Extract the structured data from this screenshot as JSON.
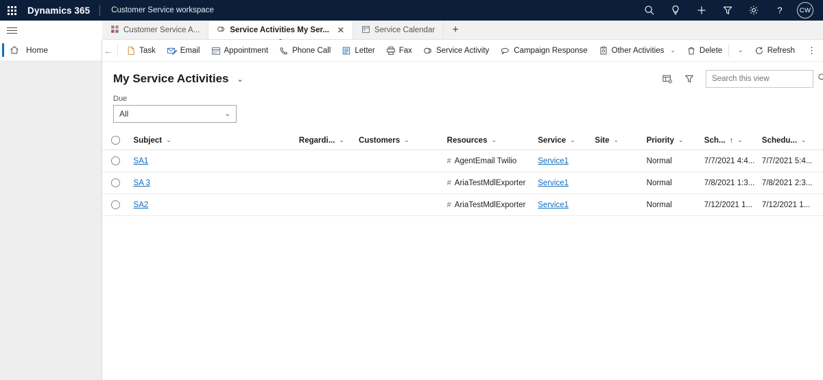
{
  "topbar": {
    "waffle_name": "app-launcher",
    "brand": "Dynamics 365",
    "app_name": "Customer Service workspace",
    "icons": [
      {
        "name": "search-icon",
        "label": "Search"
      },
      {
        "name": "lightbulb-icon",
        "label": "Tips"
      },
      {
        "name": "plus-icon",
        "label": "New"
      },
      {
        "name": "filter-icon",
        "label": "Filter"
      },
      {
        "name": "gear-icon",
        "label": "Settings"
      },
      {
        "name": "help-icon",
        "label": "Help"
      }
    ],
    "avatar_initials": "CW"
  },
  "sidebar": {
    "hamburger_label": "Site Map",
    "items": [
      {
        "label": "Home",
        "icon": "home-icon",
        "selected": true
      }
    ]
  },
  "tabs": [
    {
      "label": "Customer Service A...",
      "icon": "dashboard-icon",
      "active": false,
      "closable": false
    },
    {
      "label": "Service Activities My Ser...",
      "icon": "service-activity-icon",
      "active": true,
      "closable": true,
      "close_label": "✕",
      "unsaved_dot": true
    },
    {
      "label": "Service Calendar",
      "icon": "calendar-icon",
      "active": false,
      "closable": false
    }
  ],
  "tab_add_label": "+",
  "commandbar": {
    "back_label": "←",
    "items": [
      {
        "label": "Task",
        "icon": "task-icon"
      },
      {
        "label": "Email",
        "icon": "email-icon"
      },
      {
        "label": "Appointment",
        "icon": "appointment-icon"
      },
      {
        "label": "Phone Call",
        "icon": "phone-call-icon"
      },
      {
        "label": "Letter",
        "icon": "letter-icon"
      },
      {
        "label": "Fax",
        "icon": "fax-icon"
      },
      {
        "label": "Service Activity",
        "icon": "service-activity-icon"
      },
      {
        "label": "Campaign Response",
        "icon": "campaign-response-icon"
      },
      {
        "label": "Other Activities",
        "icon": "other-activities-icon",
        "caret": "⌄"
      },
      {
        "label": "Delete",
        "icon": "delete-icon",
        "caret": "⌄",
        "divider_after_label": true
      },
      {
        "label": "Refresh",
        "icon": "refresh-icon"
      }
    ],
    "overflow_label": "⋮"
  },
  "view": {
    "title": "My Service Activities",
    "title_caret": "⌄",
    "edit_columns_label": "Edit columns",
    "edit_filters_label": "Edit filters",
    "search_placeholder": "Search this view",
    "search_value": "",
    "filter": {
      "label": "Due",
      "value": "All",
      "caret": "⌄"
    }
  },
  "grid": {
    "select_all_label": "Select all rows",
    "columns": [
      {
        "key": "subject",
        "label": "Subject",
        "caret": "⌄"
      },
      {
        "key": "regarding",
        "label": "Regardi...",
        "caret": "⌄"
      },
      {
        "key": "customers",
        "label": "Customers",
        "caret": "⌄"
      },
      {
        "key": "resources",
        "label": "Resources",
        "caret": "⌄"
      },
      {
        "key": "service",
        "label": "Service",
        "caret": "⌄"
      },
      {
        "key": "site",
        "label": "Site",
        "caret": "⌄"
      },
      {
        "key": "priority",
        "label": "Priority",
        "caret": "⌄"
      },
      {
        "key": "sch",
        "label": "Sch...",
        "caret": "⌄",
        "sort": "↑"
      },
      {
        "key": "schedu",
        "label": "Schedu...",
        "caret": "⌄"
      }
    ],
    "rows": [
      {
        "subject": "SA1",
        "regarding": "",
        "customers": "",
        "resources": "AgentEmail Twilio",
        "service": "Service1",
        "site": "",
        "priority": "Normal",
        "sch": "7/7/2021 4:4...",
        "schedu": "7/7/2021 5:4..."
      },
      {
        "subject": "SA 3",
        "regarding": "",
        "customers": "",
        "resources": "AriaTestMdlExporter",
        "service": "Service1",
        "site": "",
        "priority": "Normal",
        "sch": "7/8/2021 1:3...",
        "schedu": "7/8/2021 2:3..."
      },
      {
        "subject": "SA2",
        "regarding": "",
        "customers": "",
        "resources": "AriaTestMdlExporter",
        "service": "Service1",
        "site": "",
        "priority": "Normal",
        "sch": "7/12/2021 1...",
        "schedu": "7/12/2021 1..."
      }
    ],
    "resource_prefix_icon": "#"
  },
  "colors": {
    "topbar_bg": "#0b1f3a",
    "accent": "#0f6cbd",
    "link": "#0f6cbd",
    "sidebar_bg": "#eeeeee",
    "unsaved_dot": "#e81123"
  }
}
